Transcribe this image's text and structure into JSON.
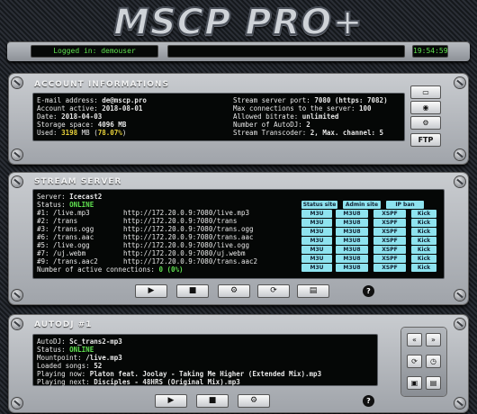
{
  "header": {
    "logo": "MSCP PRO+",
    "logged_in": "Logged in: demouser",
    "clock": "19:54:59"
  },
  "account": {
    "title": "ACCOUNT INFORMATIONS",
    "left": [
      {
        "label": "E-mail address:",
        "value": "de@mscp.pro"
      },
      {
        "label": "Account active:",
        "value": "2018-08-01"
      },
      {
        "label": "Date:",
        "value": "2018-04-03"
      },
      {
        "label": "Storage space:",
        "value": "4096 MB"
      }
    ],
    "used_label": "Used:",
    "used_value": "3198",
    "used_unit": "MB (",
    "used_pct": "78.07%",
    "used_close": ")",
    "right": [
      {
        "label": "Stream server port:",
        "value": "7080 (https: 7082)"
      },
      {
        "label": "Max connections to the server:",
        "value": "100"
      },
      {
        "label": "Allowed bitrate:",
        "value": "unlimited"
      },
      {
        "label": "Number of AutoDJ:",
        "value": "2"
      },
      {
        "label": "Stream Transcoder:",
        "value": "2, Max. channel: 5"
      }
    ],
    "side_buttons": [
      "monitor-icon",
      "eye-icon",
      "gear-icon"
    ],
    "ftp": "FTP"
  },
  "stream": {
    "title": "STREAM SERVER",
    "server_label": "Server:",
    "server": "Icecast2",
    "status_label": "Status:",
    "status": "ONLINE",
    "buttons": {
      "status_site": "Status site",
      "admin_site": "Admin site",
      "ip_ban": "IP ban"
    },
    "mounts": [
      {
        "id": "#1: /live.mp3",
        "url": "http://172.20.0.9:7080/live.mp3"
      },
      {
        "id": "#2: /trans",
        "url": "http://172.20.0.9:7080/trans"
      },
      {
        "id": "#3: /trans.ogg",
        "url": "http://172.20.0.9:7080/trans.ogg"
      },
      {
        "id": "#6: /trans.aac",
        "url": "http://172.20.0.9:7080/trans.aac"
      },
      {
        "id": "#5: /live.ogg",
        "url": "http://172.20.0.9:7080/live.ogg"
      },
      {
        "id": "#7: /uj.webm",
        "url": "http://172.20.0.9:7080/uj.webm"
      },
      {
        "id": "#9: /trans.aac2",
        "url": "http://172.20.0.9:7080/trans.aac2"
      }
    ],
    "row_buttons": [
      "M3U",
      "M3U8",
      "XSPF",
      "Kick"
    ],
    "connections_label": "Number of active connections:",
    "connections": "0",
    "connections_pct": "(0%)",
    "controls": [
      "play",
      "stop",
      "settings",
      "refresh",
      "list"
    ]
  },
  "autodj": {
    "title": "AUTODJ #1",
    "lines": [
      {
        "label": "AutoDJ:",
        "value": "Sc_trans2-mp3"
      },
      {
        "label": "Status:",
        "value": "ONLINE"
      },
      {
        "label": "Mountpoint:",
        "value": "/live.mp3"
      },
      {
        "label": "Loaded songs:",
        "value": "52"
      },
      {
        "label": "Playing now:",
        "value": "Platon feat. Joolay - Taking Me Higher (Extended Mix).mp3"
      },
      {
        "label": "Playing next:",
        "value": "Disciples - 48HRS (Original Mix).mp3"
      }
    ]
  },
  "colors": {
    "terminal_green": "#5fe04f",
    "highlight_yellow": "#e9d23a",
    "button_cyan": "#8ee3ef"
  }
}
